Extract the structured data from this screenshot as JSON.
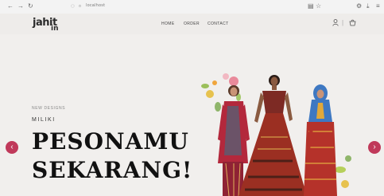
{
  "browser": {
    "url": "localhost",
    "icons": [
      "back-icon",
      "forward-icon",
      "reload-icon",
      "shield-icon",
      "page-icon",
      "reader-icon",
      "bookmark-star-icon",
      "extensions-icon",
      "download-icon",
      "menu-icon"
    ]
  },
  "header": {
    "logo_main": "jahit",
    "logo_sub": "in",
    "nav": [
      "HOME",
      "ORDER",
      "CONTACT"
    ],
    "icons": [
      "user-icon",
      "cart-icon"
    ]
  },
  "hero": {
    "small_label": "NEW DESIGNS",
    "tagline": "MILIKI",
    "headline_line1": "PESONAMU",
    "headline_line2": "SEKARANG!",
    "prev_label": "‹",
    "next_label": "›"
  },
  "colors": {
    "accent": "#c0395a",
    "header_bg": "#eeecea",
    "hero_bg": "#f1efed"
  }
}
